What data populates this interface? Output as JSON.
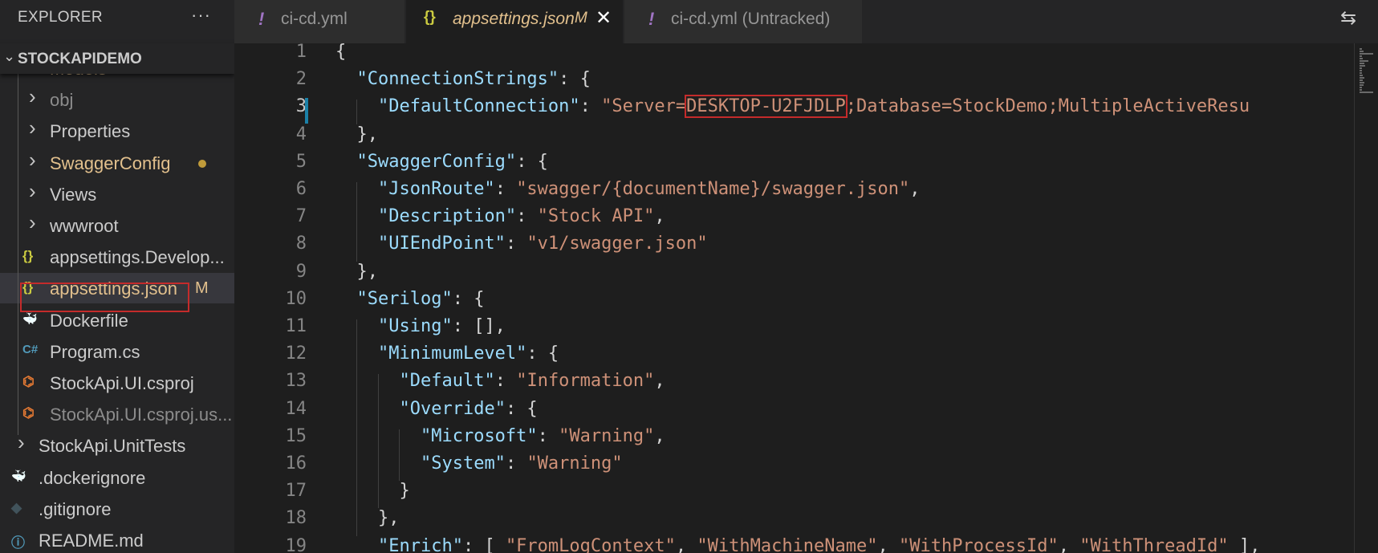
{
  "explorer": {
    "title": "EXPLORER",
    "more": "···",
    "section": "STOCKAPIDEMO",
    "items": [
      {
        "label": "Models",
        "type": "folder",
        "color": "#e2c08d",
        "modified": true
      },
      {
        "label": "obj",
        "type": "folder",
        "color": "#8c8c8c"
      },
      {
        "label": "Properties",
        "type": "folder",
        "color": "#cccccc"
      },
      {
        "label": "SwaggerConfig",
        "type": "folder",
        "color": "#e2c08d",
        "modified": true
      },
      {
        "label": "Views",
        "type": "folder",
        "color": "#cccccc"
      },
      {
        "label": "wwwroot",
        "type": "folder",
        "color": "#cccccc"
      },
      {
        "label": "appsettings.Develop...",
        "type": "json",
        "color": "#cccccc"
      },
      {
        "label": "appsettings.json",
        "type": "json",
        "color": "#e2c08d",
        "badge": "M",
        "selected": true
      },
      {
        "label": "Dockerfile",
        "type": "docker",
        "color": "#cccccc"
      },
      {
        "label": "Program.cs",
        "type": "csharp",
        "color": "#cccccc"
      },
      {
        "label": "StockApi.UI.csproj",
        "type": "rss",
        "color": "#cccccc"
      },
      {
        "label": "StockApi.UI.csproj.us...",
        "type": "rss",
        "color": "#8c8c8c"
      },
      {
        "label": "StockApi.UnitTests",
        "type": "folder",
        "color": "#cccccc"
      },
      {
        "label": ".dockerignore",
        "type": "docker",
        "color": "#cccccc"
      },
      {
        "label": ".gitignore",
        "type": "git",
        "color": "#cccccc"
      },
      {
        "label": "README.md",
        "type": "info",
        "color": "#cccccc"
      }
    ]
  },
  "tabs": [
    {
      "icon": "!",
      "title": "ci-cd.yml"
    },
    {
      "icon": "{}",
      "title": "appsettings.json",
      "modified": "M",
      "close": "✕"
    },
    {
      "icon": "!",
      "title": "ci-cd.yml (Untracked)"
    }
  ],
  "compare_icon": "⇆",
  "editor": {
    "line_numbers": [
      "1",
      "2",
      "3",
      "4",
      "5",
      "6",
      "7",
      "8",
      "9",
      "10",
      "11",
      "12",
      "13",
      "14",
      "15",
      "16",
      "17",
      "18",
      "19"
    ],
    "lines": [
      [
        {
          "t": "{",
          "c": "p"
        }
      ],
      [
        {
          "t": "  ",
          "c": "p"
        },
        {
          "t": "\"ConnectionStrings\"",
          "c": "k"
        },
        {
          "t": ": {",
          "c": "p"
        }
      ],
      [
        {
          "t": "    ",
          "c": "p"
        },
        {
          "t": "\"DefaultConnection\"",
          "c": "k"
        },
        {
          "t": ": ",
          "c": "p"
        },
        {
          "t": "\"Server=",
          "c": "s"
        },
        {
          "t": "DESKTOP-U2FJDLP",
          "c": "s",
          "hl": true
        },
        {
          "t": ";Database=StockDemo;MultipleActiveResu",
          "c": "s"
        }
      ],
      [
        {
          "t": "  },",
          "c": "p"
        }
      ],
      [
        {
          "t": "  ",
          "c": "p"
        },
        {
          "t": "\"SwaggerConfig\"",
          "c": "k"
        },
        {
          "t": ": {",
          "c": "p"
        }
      ],
      [
        {
          "t": "    ",
          "c": "p"
        },
        {
          "t": "\"JsonRoute\"",
          "c": "k"
        },
        {
          "t": ": ",
          "c": "p"
        },
        {
          "t": "\"swagger/{documentName}/swagger.json\"",
          "c": "s"
        },
        {
          "t": ",",
          "c": "p"
        }
      ],
      [
        {
          "t": "    ",
          "c": "p"
        },
        {
          "t": "\"Description\"",
          "c": "k"
        },
        {
          "t": ": ",
          "c": "p"
        },
        {
          "t": "\"Stock API\"",
          "c": "s"
        },
        {
          "t": ",",
          "c": "p"
        }
      ],
      [
        {
          "t": "    ",
          "c": "p"
        },
        {
          "t": "\"UIEndPoint\"",
          "c": "k"
        },
        {
          "t": ": ",
          "c": "p"
        },
        {
          "t": "\"v1/swagger.json\"",
          "c": "s"
        }
      ],
      [
        {
          "t": "  },",
          "c": "p"
        }
      ],
      [
        {
          "t": "  ",
          "c": "p"
        },
        {
          "t": "\"Serilog\"",
          "c": "k"
        },
        {
          "t": ": {",
          "c": "p"
        }
      ],
      [
        {
          "t": "    ",
          "c": "p"
        },
        {
          "t": "\"Using\"",
          "c": "k"
        },
        {
          "t": ": [],",
          "c": "p"
        }
      ],
      [
        {
          "t": "    ",
          "c": "p"
        },
        {
          "t": "\"MinimumLevel\"",
          "c": "k"
        },
        {
          "t": ": {",
          "c": "p"
        }
      ],
      [
        {
          "t": "      ",
          "c": "p"
        },
        {
          "t": "\"Default\"",
          "c": "k"
        },
        {
          "t": ": ",
          "c": "p"
        },
        {
          "t": "\"Information\"",
          "c": "s"
        },
        {
          "t": ",",
          "c": "p"
        }
      ],
      [
        {
          "t": "      ",
          "c": "p"
        },
        {
          "t": "\"Override\"",
          "c": "k"
        },
        {
          "t": ": {",
          "c": "p"
        }
      ],
      [
        {
          "t": "        ",
          "c": "p"
        },
        {
          "t": "\"Microsoft\"",
          "c": "k"
        },
        {
          "t": ": ",
          "c": "p"
        },
        {
          "t": "\"Warning\"",
          "c": "s"
        },
        {
          "t": ",",
          "c": "p"
        }
      ],
      [
        {
          "t": "        ",
          "c": "p"
        },
        {
          "t": "\"System\"",
          "c": "k"
        },
        {
          "t": ": ",
          "c": "p"
        },
        {
          "t": "\"Warning\"",
          "c": "s"
        }
      ],
      [
        {
          "t": "      }",
          "c": "p"
        }
      ],
      [
        {
          "t": "    },",
          "c": "p"
        }
      ],
      [
        {
          "t": "    ",
          "c": "p"
        },
        {
          "t": "\"Enrich\"",
          "c": "k"
        },
        {
          "t": ": [ ",
          "c": "p"
        },
        {
          "t": "\"FromLogContext\"",
          "c": "s"
        },
        {
          "t": ", ",
          "c": "p"
        },
        {
          "t": "\"WithMachineName\"",
          "c": "s"
        },
        {
          "t": ", ",
          "c": "p"
        },
        {
          "t": "\"WithProcessId\"",
          "c": "s"
        },
        {
          "t": ", ",
          "c": "p"
        },
        {
          "t": "\"WithThreadId\"",
          "c": "s"
        },
        {
          "t": " ],",
          "c": "p"
        }
      ]
    ]
  },
  "colors": {
    "accent": "#1b81a8",
    "highlight": "#c42b2b",
    "modified": "#e2c08d",
    "json_icon": "#cbcb41",
    "yaml_icon": "#a074c4",
    "csharp_icon": "#519aba",
    "rss_icon": "#e37933",
    "docker_icon": "#519aba"
  }
}
